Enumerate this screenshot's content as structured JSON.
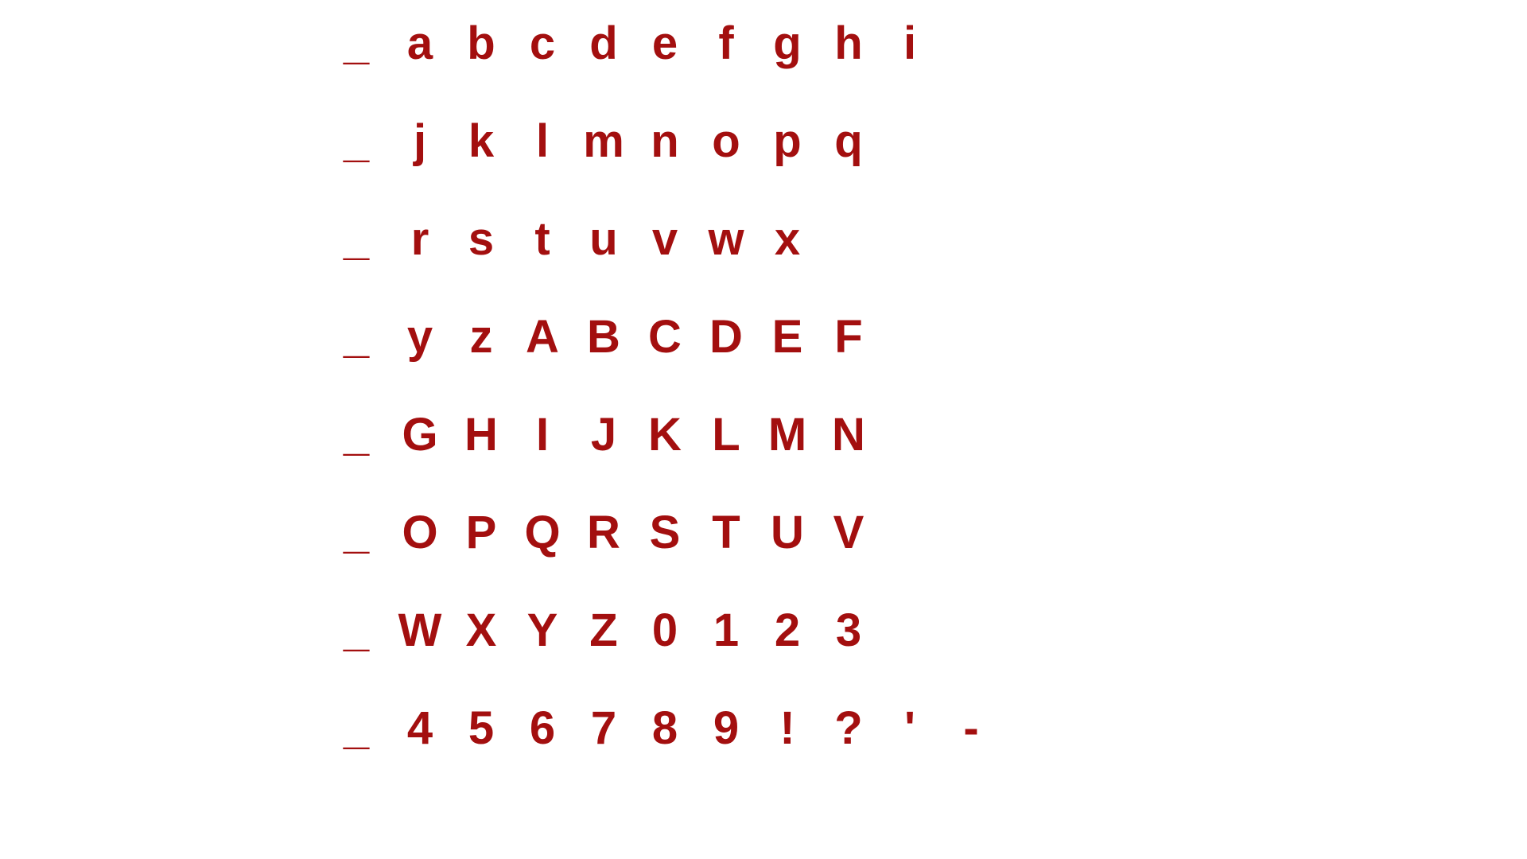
{
  "theme": {
    "text_color": "#a30f0f",
    "background": "#ffffff"
  },
  "keyboard": {
    "rows": [
      {
        "selector": "_",
        "keys": [
          "a",
          "b",
          "c",
          "d",
          "e",
          "f",
          "g",
          "h",
          "i"
        ]
      },
      {
        "selector": "_",
        "keys": [
          "j",
          "k",
          "l",
          "m",
          "n",
          "o",
          "p",
          "q"
        ]
      },
      {
        "selector": "_",
        "keys": [
          "r",
          "s",
          "t",
          "u",
          "v",
          "w",
          "x"
        ]
      },
      {
        "selector": "_",
        "keys": [
          "y",
          "z",
          "A",
          "B",
          "C",
          "D",
          "E",
          "F"
        ]
      },
      {
        "selector": "_",
        "keys": [
          "G",
          "H",
          "I",
          "J",
          "K",
          "L",
          "M",
          "N"
        ]
      },
      {
        "selector": "_",
        "keys": [
          "O",
          "P",
          "Q",
          "R",
          "S",
          "T",
          "U",
          "V"
        ]
      },
      {
        "selector": "_",
        "keys": [
          "W",
          "X",
          "Y",
          "Z",
          "0",
          "1",
          "2",
          "3"
        ]
      },
      {
        "selector": "_",
        "keys": [
          "4",
          "5",
          "6",
          "7",
          "8",
          "9",
          "!",
          "?",
          "'",
          "-"
        ]
      }
    ]
  }
}
